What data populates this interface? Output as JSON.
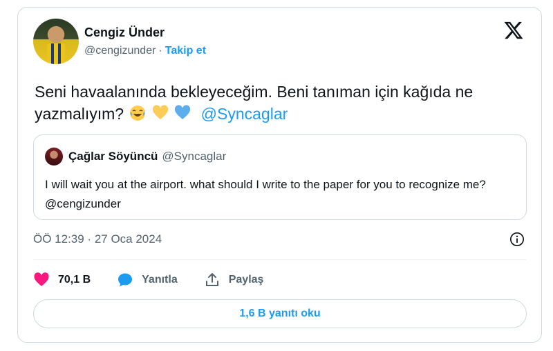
{
  "author": {
    "name": "Cengiz Ünder",
    "handle": "@cengizunder",
    "separator": "·",
    "follow_label": "Takip et"
  },
  "tweet": {
    "text": "Seni havaalanında bekleyeceğim. Beni tanıman için kağıda ne yazmalıyım?",
    "emojis": [
      "face-with-tears-of-joy",
      "yellow-heart",
      "blue-heart"
    ],
    "mention": "@Syncaglar"
  },
  "quote": {
    "name": "Çağlar Söyüncü",
    "handle": "@Syncaglar",
    "text": "I will wait you at the airport. what should I write to the paper for you to recognize me? @cengizunder"
  },
  "meta": {
    "timestamp": "ÖÖ 12:39 · 27 Oca 2024"
  },
  "actions": {
    "like_count": "70,1 B",
    "reply_label": "Yanıtla",
    "share_label": "Paylaş"
  },
  "replies_button": "1,6 B yanıtı oku",
  "icons": {
    "x_logo": "x-logo-icon",
    "info": "info-icon",
    "like": "heart-icon",
    "reply": "speech-bubble-icon",
    "share": "share-icon"
  },
  "colors": {
    "accent": "#1d9bf0",
    "like": "#f91880",
    "text": "#0f1419",
    "secondary": "#536471",
    "border": "#cfd9de"
  }
}
